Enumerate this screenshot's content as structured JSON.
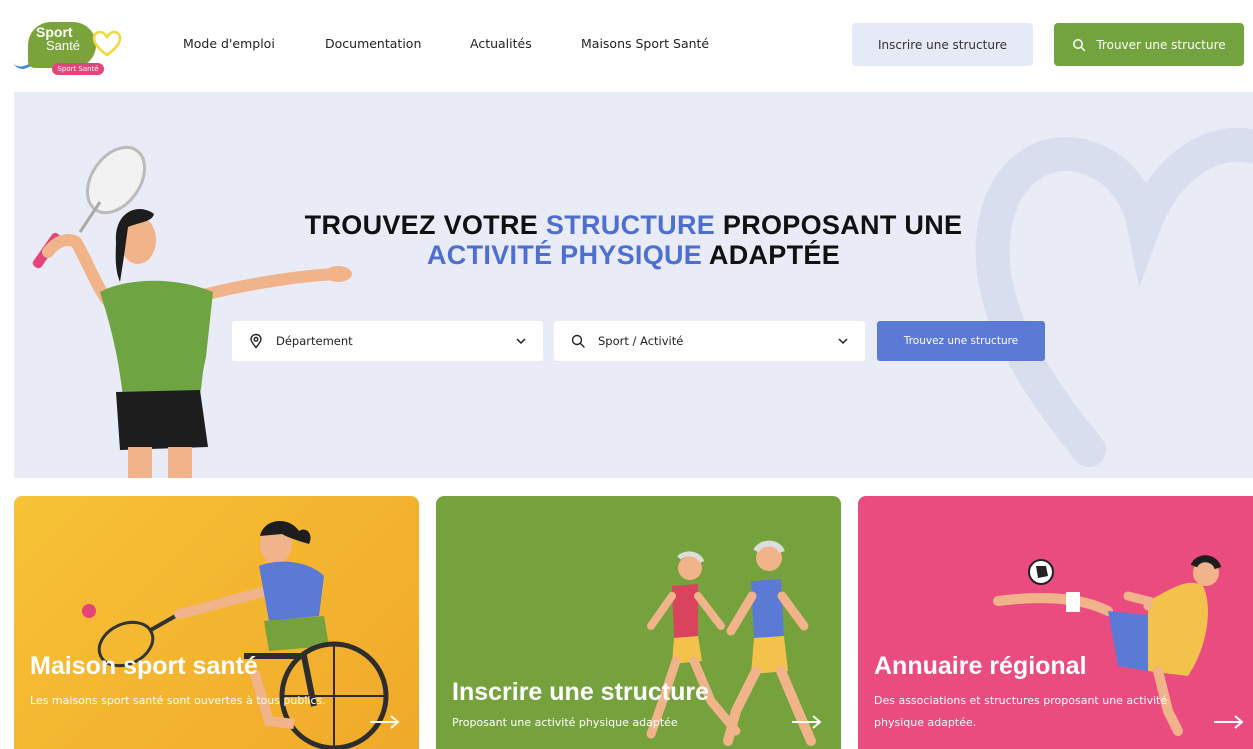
{
  "logo": {
    "line1": "Sport",
    "line2": "Santé",
    "tag": "Sport Santé"
  },
  "nav": {
    "items": [
      "Mode d'emploi",
      "Documentation",
      "Actualités",
      "Maisons Sport Santé"
    ]
  },
  "header_buttons": {
    "register": "Inscrire une structure",
    "find": "Trouver une structure"
  },
  "hero": {
    "title_part1": "TROUVEZ VOTRE ",
    "title_highlight1": "STRUCTURE",
    "title_part2": " PROPOSANT UNE",
    "title_highlight2": "ACTIVITÉ PHYSIQUE",
    "title_part3": " ADAPTÉE",
    "department_placeholder": "Département",
    "activity_placeholder": "Sport / Activité",
    "search_button": "Trouvez une structure"
  },
  "cards": [
    {
      "title": "Maison sport santé",
      "description": "Les maisons sport santé sont ouvertes à tous publics."
    },
    {
      "title": "Inscrire une structure",
      "description": "Proposant une activité physique adaptée"
    },
    {
      "title": "Annuaire régional",
      "description": "Des associations et structures proposant une activité physique adaptée."
    }
  ],
  "colors": {
    "green": "#73a33e",
    "blue": "#5a7ad6",
    "hero_bg": "#e9ebf7",
    "yellow": "#f3b630",
    "pink": "#ea4c7f"
  },
  "icons": [
    "location-pin-icon",
    "search-icon",
    "chevron-down-icon",
    "arrow-right-icon",
    "heart-icon"
  ]
}
